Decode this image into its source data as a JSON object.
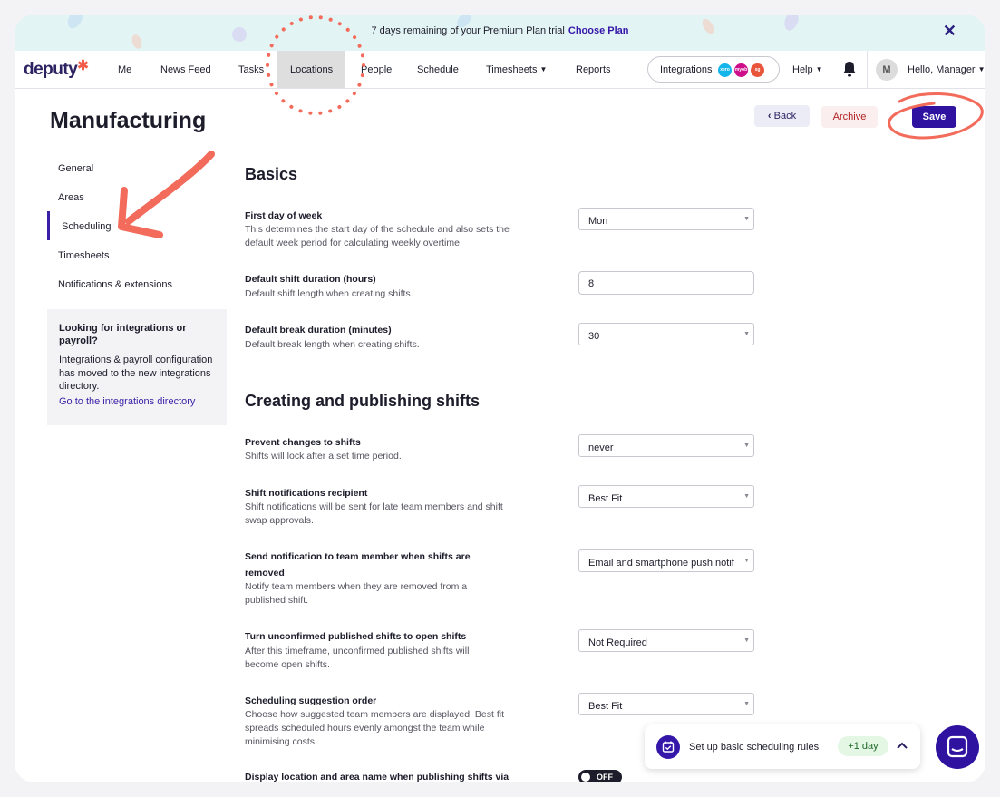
{
  "banner": {
    "text": "7 days remaining of your Premium Plan trial",
    "link": "Choose Plan",
    "close": "✕"
  },
  "nav": {
    "logo": "deputy",
    "items": [
      "Me",
      "News Feed",
      "Tasks",
      "Locations",
      "People",
      "Schedule",
      "Timesheets",
      "Reports"
    ],
    "active": "Locations",
    "integrations": {
      "label": "Integrations",
      "badges": [
        "xero",
        "myob",
        "sg"
      ],
      "badge_colors": [
        "#13b5ea",
        "#cf0f8a",
        "#e8553a"
      ]
    },
    "help": "Help",
    "avatar": "M",
    "greeting": "Hello, Manager"
  },
  "page": {
    "title": "Manufacturing",
    "back": "Back",
    "archive": "Archive",
    "save": "Save"
  },
  "sidebar": {
    "items": [
      "General",
      "Areas",
      "Scheduling",
      "Timesheets",
      "Notifications & extensions"
    ],
    "active": "Scheduling",
    "box": {
      "heading": "Looking for integrations or payroll?",
      "text": "Integrations & payroll configuration has moved to the new integrations directory.",
      "link": "Go to the integrations directory"
    }
  },
  "basics": {
    "title": "Basics",
    "first_day": {
      "label": "First day of week",
      "desc": "This determines the start day of the schedule and also sets the default week period for calculating weekly overtime.",
      "value": "Mon"
    },
    "shift_duration": {
      "label": "Default shift duration (hours)",
      "desc": "Default shift length when creating shifts.",
      "value": "8"
    },
    "break_duration": {
      "label": "Default break duration (minutes)",
      "desc": "Default break length when creating shifts.",
      "value": "30"
    }
  },
  "creating": {
    "title": "Creating and publishing shifts",
    "prevent": {
      "label": "Prevent changes to shifts",
      "desc": "Shifts will lock after a set time period.",
      "value": "never"
    },
    "recipient": {
      "label": "Shift notifications recipient",
      "desc": "Shift notifications will be sent for late team members and shift swap approvals.",
      "value": "Best Fit"
    },
    "removed": {
      "label": "Send notification to team member when shifts are removed",
      "desc": "Notify team members when they are removed from a published shift.",
      "value": "Email and smartphone push notif"
    },
    "unconfirmed": {
      "label": "Turn unconfirmed published shifts to open shifts",
      "desc": "After this timeframe, unconfirmed published shifts will become open shifts.",
      "value": "Not Required"
    },
    "suggestion": {
      "label": "Scheduling suggestion order",
      "desc": "Choose how suggested team members are displayed. Best fit spreads scheduled hours evenly amongst the team while minimising costs.",
      "value": "Best Fit"
    },
    "display_location": {
      "label": "Display location and area name when publishing shifts via",
      "toggle": "OFF"
    }
  },
  "task_card": {
    "text": "Set up basic scheduling rules",
    "badge": "+1 day"
  },
  "colors": {
    "brand": "#2f13a0",
    "annotation": "#f26b5b",
    "banner_bg": "#e3f4f4"
  }
}
